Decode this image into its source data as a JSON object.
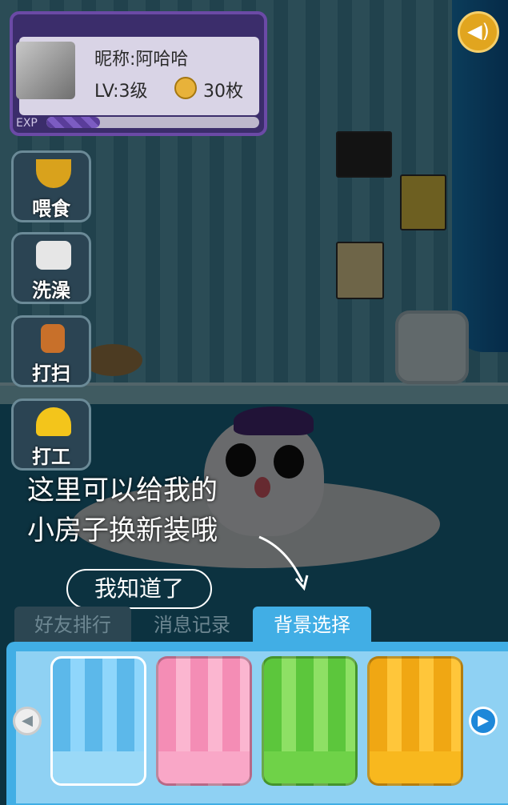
{
  "profile": {
    "nickname": "昵称:阿哈哈",
    "level": "LV:3级",
    "coins": "30枚",
    "exp_label": "EXP",
    "exp_fraction": 0.25
  },
  "actions": [
    {
      "label": "喂食",
      "icon": "bowl-icon"
    },
    {
      "label": "洗澡",
      "icon": "soap-icon"
    },
    {
      "label": "打扫",
      "icon": "broom-icon"
    },
    {
      "label": "打工",
      "icon": "hardhat-icon"
    }
  ],
  "tutorial": {
    "line1": "这里可以给我的",
    "line2": "小房子换新装哦",
    "ok_label": "我知道了"
  },
  "tabs": [
    {
      "label": "好友排行",
      "active": false
    },
    {
      "label": "消息记录",
      "active": false
    },
    {
      "label": "背景选择",
      "active": true
    }
  ],
  "backgrounds": [
    {
      "name": "blue",
      "color": "#5cb8ea",
      "stripe": "#8fd6fb",
      "base": "#9ad9f7",
      "selected": true
    },
    {
      "name": "pink",
      "color": "#f48db5",
      "stripe": "#fbb6d0",
      "base": "#f9a7c7",
      "selected": false
    },
    {
      "name": "green",
      "color": "#5cc63c",
      "stripe": "#8ee065",
      "base": "#6fd248",
      "selected": false
    },
    {
      "name": "orange",
      "color": "#f0a713",
      "stripe": "#ffc63a",
      "base": "#f8b81e",
      "selected": false
    }
  ],
  "icons": {
    "sound": "sound-icon",
    "coin": "coin-icon",
    "prev": "left-arrow-icon",
    "next": "right-arrow-icon"
  }
}
